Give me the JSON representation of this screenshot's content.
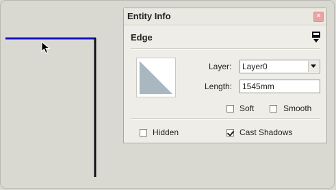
{
  "panel": {
    "title": "Entity Info",
    "close_symbol": "×",
    "entity_type": "Edge",
    "layer_label": "Layer:",
    "layer_value": "Layer0",
    "length_label": "Length:",
    "length_value": "1545mm",
    "soft_label": "Soft",
    "soft_checked": false,
    "smooth_label": "Smooth",
    "smooth_checked": false,
    "hidden_label": "Hidden",
    "hidden_checked": false,
    "cast_shadows_label": "Cast Shadows",
    "cast_shadows_checked": true
  },
  "colors": {
    "canvas": "#d9d9d2",
    "edge_selected": "#1414c8",
    "edge_default": "#111111",
    "material_swatch": "#a9b7c1"
  },
  "icons": {
    "cursor": "pointer-arrow-icon",
    "close": "close-icon",
    "expand": "panel-toggle-icon",
    "dropdown": "chevron-down-icon"
  }
}
